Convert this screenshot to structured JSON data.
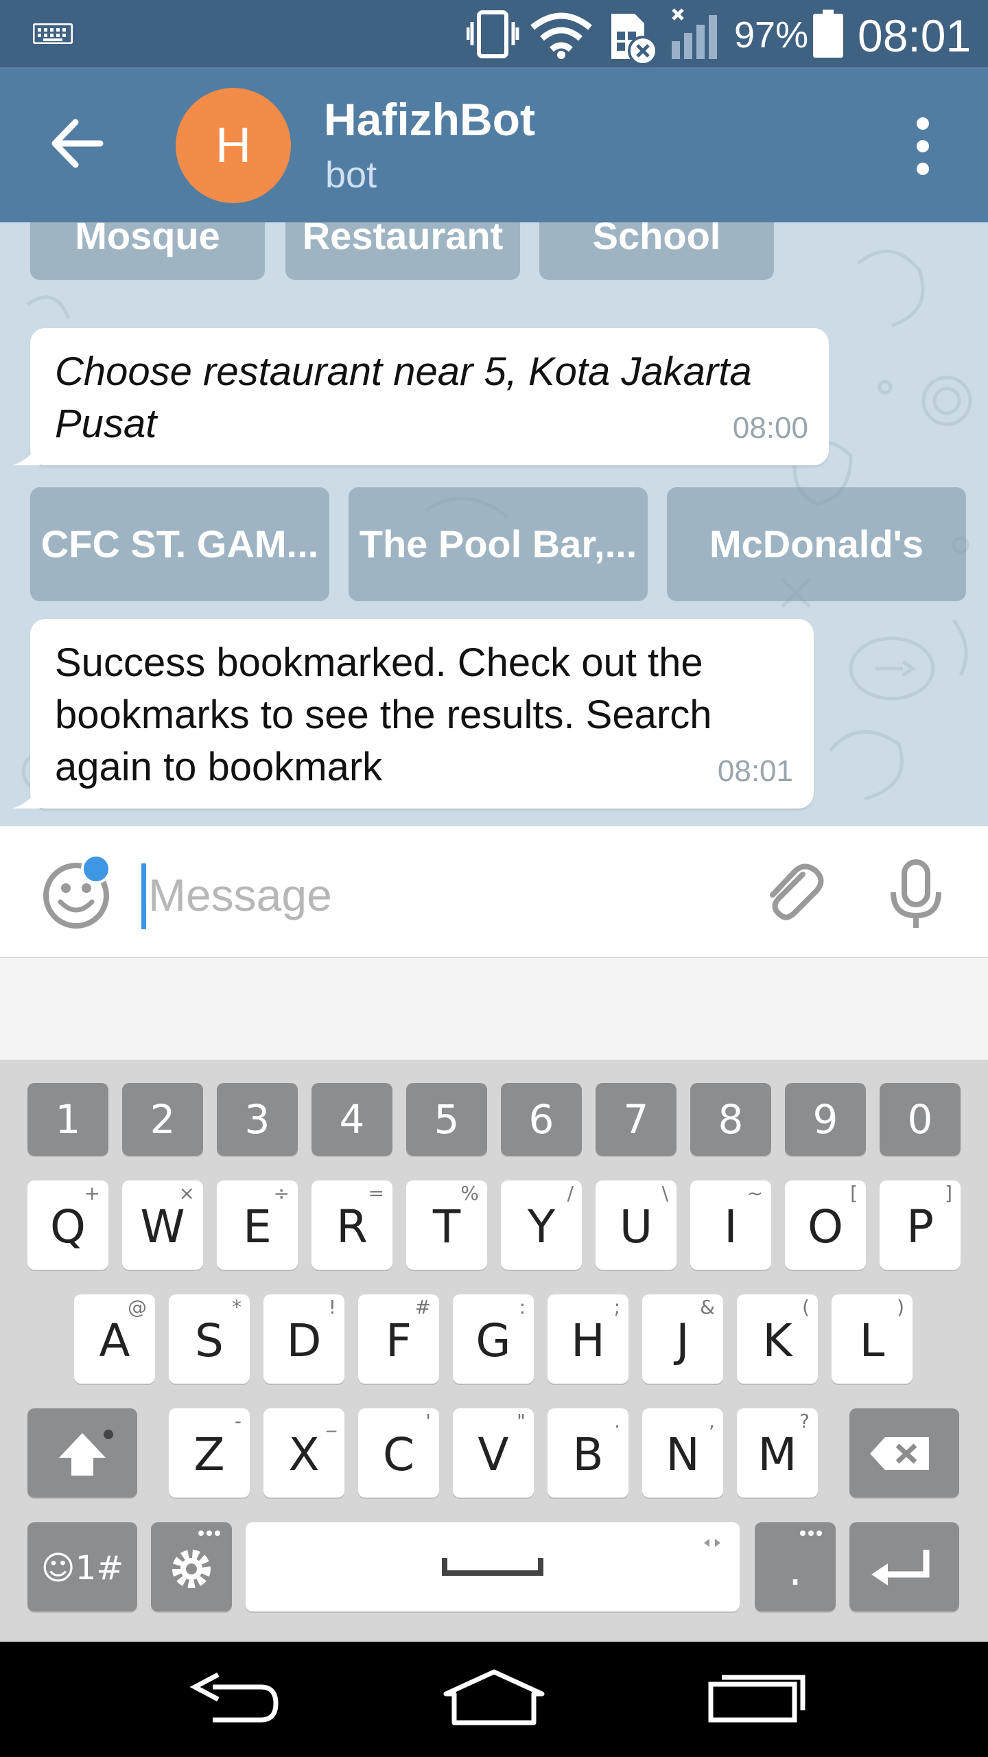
{
  "status_bar": {
    "battery_percent": "97%",
    "time": "08:01"
  },
  "chat_header": {
    "avatar_letter": "H",
    "title": "HafizhBot",
    "subtitle": "bot"
  },
  "top_keyboard_row": [
    "Mosque",
    "Restaurant",
    "School"
  ],
  "messages": [
    {
      "text": "Choose restaurant near 5, Kota Jakarta Pusat",
      "time": "08:00",
      "italic": true
    },
    {
      "text": "Success bookmarked. Check out the bookmarks to see the results. Search again to bookmark",
      "time": "08:01",
      "italic": false
    }
  ],
  "restaurant_keyboard_row": [
    "CFC ST. GAM...",
    "The Pool Bar,...",
    "McDonald's"
  ],
  "composer": {
    "placeholder": "Message"
  },
  "keyboard": {
    "numbers": [
      "1",
      "2",
      "3",
      "4",
      "5",
      "6",
      "7",
      "8",
      "9",
      "0"
    ],
    "row1": [
      {
        "key": "Q",
        "alt": "+"
      },
      {
        "key": "W",
        "alt": "×"
      },
      {
        "key": "E",
        "alt": "÷"
      },
      {
        "key": "R",
        "alt": "="
      },
      {
        "key": "T",
        "alt": "%"
      },
      {
        "key": "Y",
        "alt": "/"
      },
      {
        "key": "U",
        "alt": "\\"
      },
      {
        "key": "I",
        "alt": "~"
      },
      {
        "key": "O",
        "alt": "["
      },
      {
        "key": "P",
        "alt": "]"
      }
    ],
    "row2": [
      {
        "key": "A",
        "alt": "@"
      },
      {
        "key": "S",
        "alt": "*"
      },
      {
        "key": "D",
        "alt": "!"
      },
      {
        "key": "F",
        "alt": "#"
      },
      {
        "key": "G",
        "alt": ":"
      },
      {
        "key": "H",
        "alt": ";"
      },
      {
        "key": "J",
        "alt": "&"
      },
      {
        "key": "K",
        "alt": "("
      },
      {
        "key": "L",
        "alt": ")"
      }
    ],
    "row3": [
      {
        "key": "Z",
        "alt": "-"
      },
      {
        "key": "X",
        "alt": "_"
      },
      {
        "key": "C",
        "alt": "'"
      },
      {
        "key": "V",
        "alt": "\""
      },
      {
        "key": "B",
        "alt": "."
      },
      {
        "key": "N",
        "alt": ","
      },
      {
        "key": "M",
        "alt": "?"
      }
    ],
    "symbols_key": "☺1#",
    "period_key": "."
  },
  "colors": {
    "status_bar": "#3f6182",
    "app_bar": "#527da3",
    "avatar": "#f28c48",
    "chat_background": "#ccdbe5",
    "accent": "#3e97e4"
  },
  "icons": {
    "status": [
      "keyboard-icon",
      "vibrate-icon",
      "wifi-icon",
      "sim-off-icon",
      "signal-icon",
      "battery-icon"
    ],
    "header": [
      "back-arrow-icon",
      "more-vert-icon"
    ],
    "composer": [
      "emoji-icon",
      "attach-icon",
      "mic-icon"
    ],
    "navigation": [
      "nav-back-icon",
      "nav-home-icon",
      "nav-recent-icon"
    ]
  }
}
